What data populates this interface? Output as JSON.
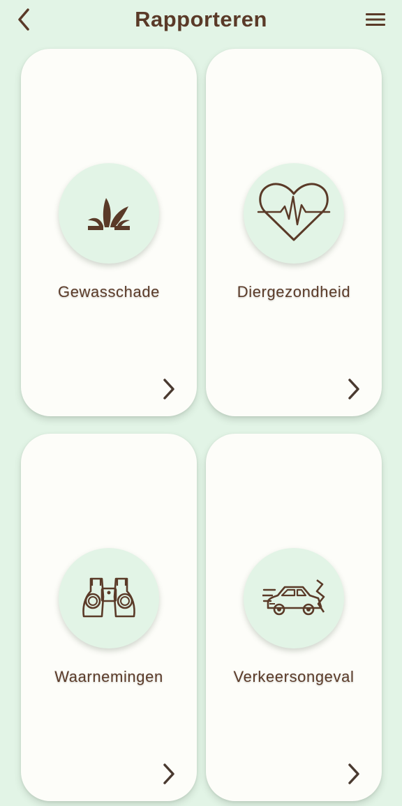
{
  "header": {
    "title": "Rapporteren",
    "back_icon": "back-chevron-icon",
    "menu_icon": "hamburger-menu-icon"
  },
  "colors": {
    "background": "#e2f4e6",
    "card": "#fdfdf9",
    "accent": "#5a3a28"
  },
  "cards": [
    {
      "label": "Gewasschade",
      "icon": "crop-sprout-icon"
    },
    {
      "label": "Diergezondheid",
      "icon": "heart-pulse-icon"
    },
    {
      "label": "Waarnemingen",
      "icon": "binoculars-icon"
    },
    {
      "label": "Verkeersongeval",
      "icon": "car-crash-icon"
    }
  ]
}
